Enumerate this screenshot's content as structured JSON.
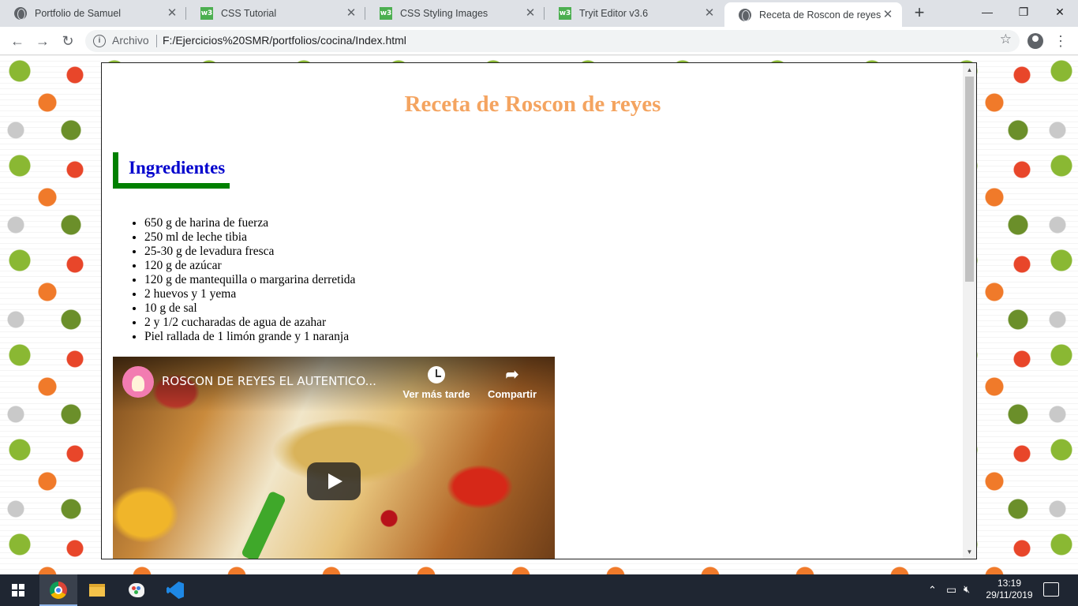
{
  "browser": {
    "tabs": [
      {
        "title": "Portfolio de Samuel",
        "icon": "globe-icon"
      },
      {
        "title": "CSS Tutorial",
        "icon": "w3schools-icon"
      },
      {
        "title": "CSS Styling Images",
        "icon": "w3schools-icon"
      },
      {
        "title": "Tryit Editor v3.6",
        "icon": "w3schools-icon"
      },
      {
        "title": "Receta de Roscon de reyes",
        "icon": "globe-icon",
        "active": true
      }
    ],
    "close_glyph": "✕",
    "new_tab_glyph": "+",
    "window_controls": {
      "minimize": "—",
      "maximize": "❐",
      "close": "✕"
    },
    "nav": {
      "back": "←",
      "forward": "→",
      "reload": "↻"
    },
    "address": {
      "info_glyph": "i",
      "protocol_label": "Archivo",
      "url": "F:/Ejercicios%20SMR/portfolios/cocina/Index.html",
      "star_glyph": "☆"
    },
    "menu_glyph": "⋮"
  },
  "page": {
    "title": "Receta de Roscon de reyes",
    "section_heading": "Ingredientes",
    "ingredients": [
      "650 g de harina de fuerza",
      "250 ml de leche tibia",
      "25-30 g de levadura fresca",
      "120 g de azúcar",
      "120 g de mantequilla o margarina derretida",
      "2 huevos y 1 yema",
      "10 g de sal",
      "2 y 1/2 cucharadas de agua de azahar",
      "Piel rallada de 1 limón grande y 1 naranja"
    ],
    "video": {
      "title": "ROSCON DE REYES EL AUTENTICO...",
      "watch_later": "Ver más tarde",
      "share": "Compartir",
      "share_glyph": "➦"
    },
    "colors": {
      "title": "#f4a460",
      "heading": "#0000cd",
      "heading_border": "#008000"
    }
  },
  "taskbar": {
    "time": "13:19",
    "date": "29/11/2019",
    "tray_glyphs": {
      "chevron": "⌃",
      "network": "▭",
      "volume": "🔇︎"
    }
  }
}
